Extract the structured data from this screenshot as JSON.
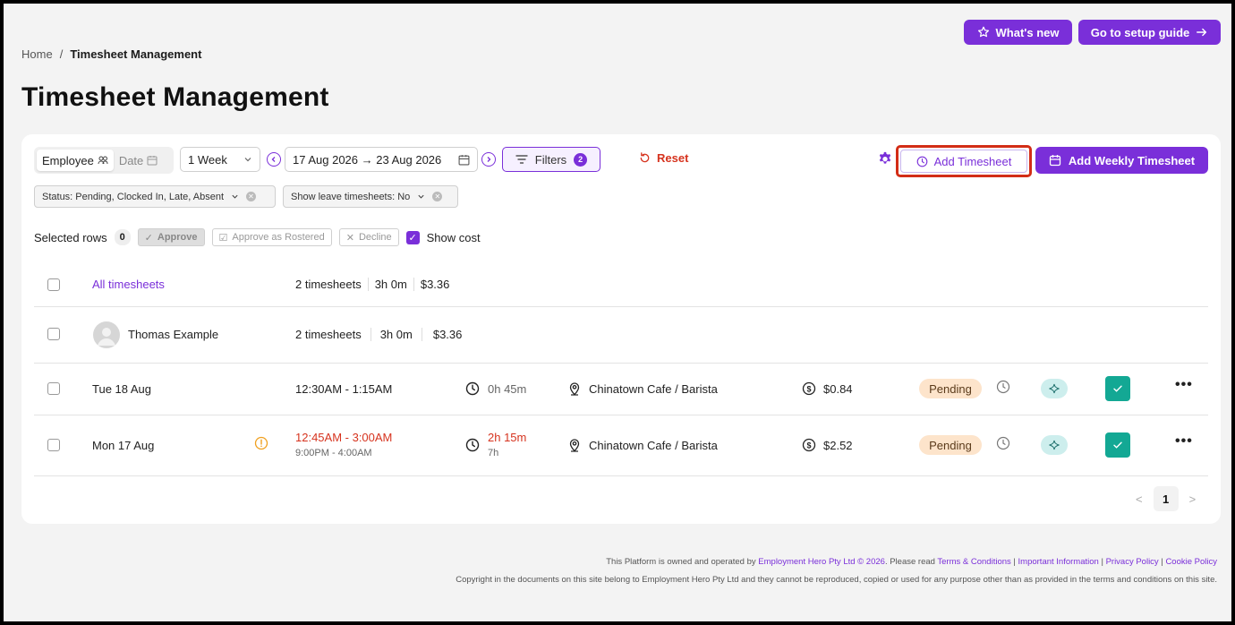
{
  "header": {
    "whats_new": "What's new",
    "setup_guide": "Go to setup guide"
  },
  "breadcrumb": {
    "home": "Home",
    "separator": "/",
    "current": "Timesheet Management"
  },
  "page_title": "Timesheet Management",
  "toolbar": {
    "view_employee": "Employee",
    "view_date": "Date",
    "period": "1 Week",
    "date_range": "17 Aug 2026 → 23 Aug 2026",
    "filters_label": "Filters",
    "filters_count": "2",
    "reset": "Reset",
    "add_timesheet": "Add Timesheet",
    "add_weekly": "Add Weekly Timesheet"
  },
  "chips": [
    {
      "label": "Status: Pending, Clocked In, Late, Absent"
    },
    {
      "label": "Show leave timesheets: No"
    }
  ],
  "selection": {
    "label": "Selected rows",
    "count": "0",
    "approve": "Approve",
    "approve_rostered": "Approve as Rostered",
    "decline": "Decline",
    "show_cost": "Show cost"
  },
  "all_row": {
    "label": "All timesheets",
    "count": "2 timesheets",
    "hours": "3h 0m",
    "cost": "$3.36"
  },
  "employee_row": {
    "name": "Thomas Example",
    "count": "2 timesheets",
    "hours": "3h 0m",
    "cost": "$3.36"
  },
  "rows": [
    {
      "date": "Tue 18 Aug",
      "time": "12:30AM - 1:15AM",
      "rostered": "",
      "duration": "0h 45m",
      "duration_sub": "",
      "location": "Chinatown Cafe / Barista",
      "cost": "$0.84",
      "status": "Pending"
    },
    {
      "date": "Mon 17 Aug",
      "time": "12:45AM - 3:00AM",
      "rostered": "9:00PM - 4:00AM",
      "duration": "2h 15m",
      "duration_sub": "7h",
      "location": "Chinatown Cafe / Barista",
      "cost": "$2.52",
      "status": "Pending"
    }
  ],
  "pagination": {
    "prev": "<",
    "page": "1",
    "next": ">"
  },
  "footer": {
    "line1_prefix": "This Platform is owned and operated by",
    "company": "Employment Hero Pty Ltd © 2026",
    "line1_mid": ". Please read",
    "terms": "Terms & Conditions",
    "important": "Important Information",
    "privacy": "Privacy Policy",
    "cookie": "Cookie Policy",
    "line2": "Copyright in the documents on this site belong to Employment Hero Pty Ltd and they cannot be reproduced, copied or used for any purpose other than as provided in the terms and conditions on this site."
  },
  "colors": {
    "accent": "#7a2fd9",
    "danger": "#d6331e",
    "success": "#13a894",
    "pending_bg": "#fde4cb"
  }
}
